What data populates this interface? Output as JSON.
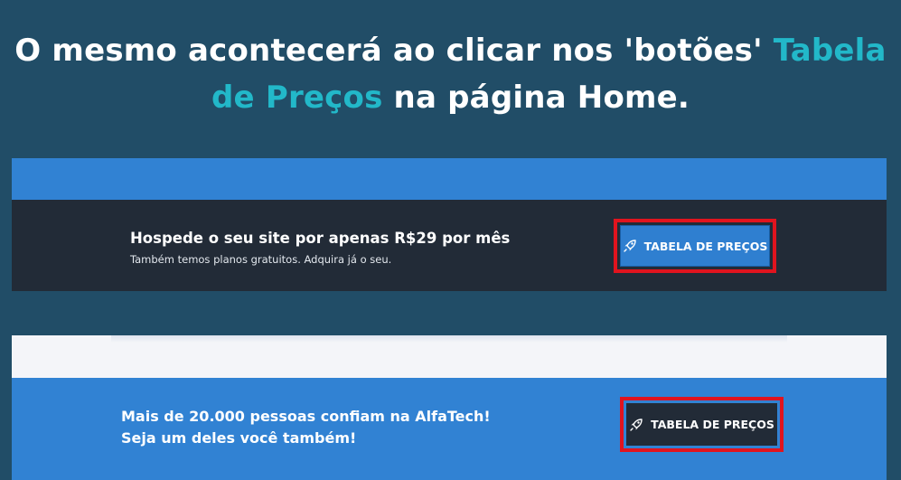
{
  "headline": {
    "part1": "O mesmo acontecerá ao clicar nos 'botões' ",
    "accent": "Tabela de Preços",
    "part2": " na página Home."
  },
  "banner_hosting": {
    "title": "Hospede o seu site por apenas R$29 por mês",
    "subtitle": "Também temos planos gratuitos. Adquira já o seu.",
    "button_label": "TABELA DE PREÇOS",
    "button_icon": "rocket-icon"
  },
  "banner_trust": {
    "line1": "Mais de 20.000 pessoas confiam na AlfaTech!",
    "line2": "Seja um deles você também!",
    "button_label": "TABELA DE PREÇOS",
    "button_icon": "rocket-icon"
  },
  "colors": {
    "background": "#214d67",
    "accent": "#22b8c9",
    "blue": "#3182d3",
    "dark": "#222b37",
    "highlight": "#e1141e"
  }
}
